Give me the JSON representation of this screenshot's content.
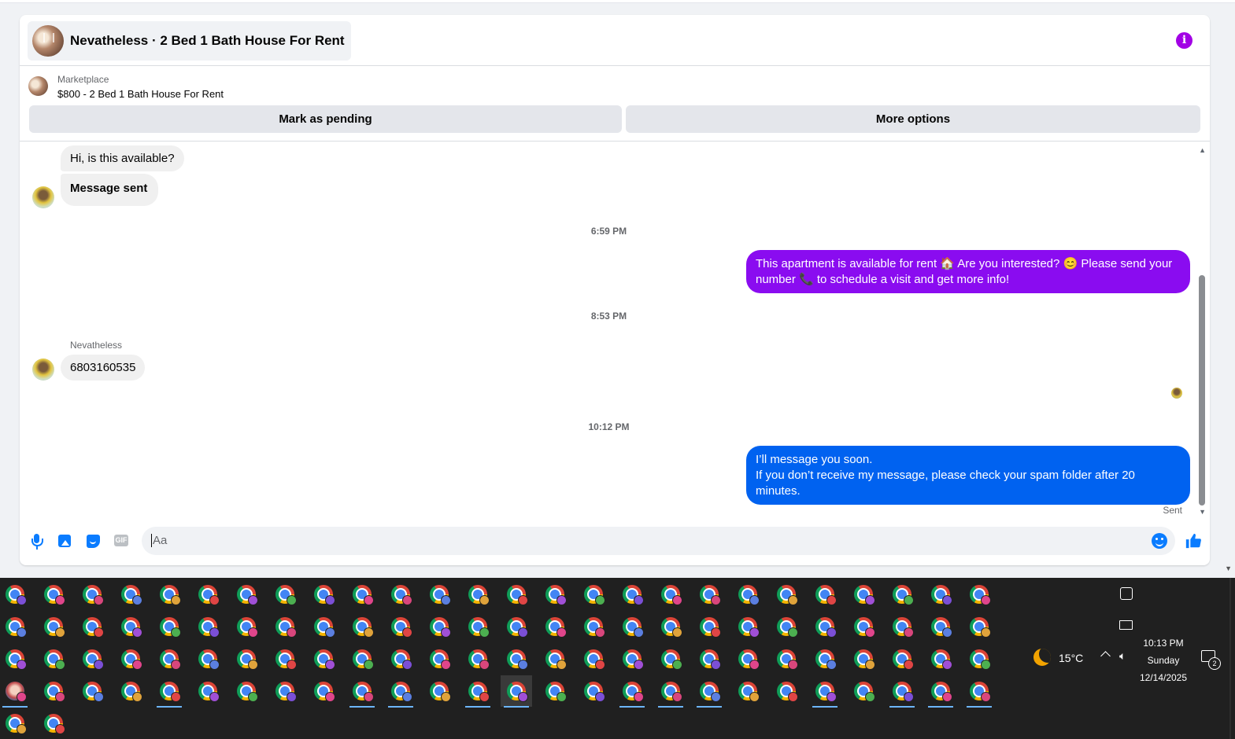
{
  "chat": {
    "header_title": "Nevatheless · 2 Bed 1 Bath House For Rent",
    "marketplace_label": "Marketplace",
    "listing": "$800 - 2 Bed 1 Bath House For Rent",
    "mark_pending": "Mark as pending",
    "more_options": "More options"
  },
  "messages": {
    "incoming_1": "Hi, is this available?",
    "incoming_2": "Message sent",
    "time_1": "6:59 PM",
    "outgoing_1": "This apartment is available for rent 🏠 Are you interested? 😊 Please send your number 📞 to schedule a visit and get more info!",
    "time_2": "8:53 PM",
    "sender_name": "Nevatheless",
    "incoming_3": "6803160535",
    "time_3": "10:12 PM",
    "outgoing_2": "I’ll message you soon.\n        If you don’t receive my message, please check your spam folder after 20 minutes.",
    "sent_status": "Sent"
  },
  "composer": {
    "placeholder": "Aa",
    "gif_label": "GIF"
  },
  "taskbar": {
    "weather_temp": "15°C",
    "time": "10:13 PM",
    "day": "Sunday",
    "date": "12/14/2025",
    "notification_count": "2"
  },
  "colors": {
    "outgoing_purple": "#8a0cf0",
    "outgoing_blue": "#0062f0",
    "accent": "#0a7cff",
    "info": "#a200e5"
  }
}
